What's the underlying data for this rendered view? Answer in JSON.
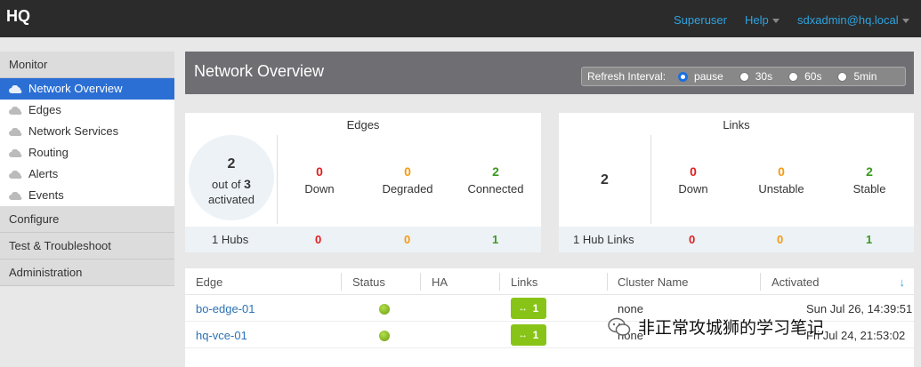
{
  "topbar": {
    "brand": "HQ",
    "superuser": "Superuser",
    "help": "Help",
    "user": "sdxadmin@hq.local"
  },
  "sidebar": {
    "monitor": "Monitor",
    "items": [
      {
        "label": "Network Overview",
        "icon": "cloud-icon",
        "active": true
      },
      {
        "label": "Edges",
        "icon": "cloud-icon"
      },
      {
        "label": "Network Services",
        "icon": "cloud-icon"
      },
      {
        "label": "Routing",
        "icon": "cloud-icon"
      },
      {
        "label": "Alerts",
        "icon": "cloud-icon"
      },
      {
        "label": "Events",
        "icon": "cloud-icon"
      }
    ],
    "configure": "Configure",
    "test": "Test & Troubleshoot",
    "admin": "Administration"
  },
  "banner": {
    "title": "Network Overview",
    "refresh_label": "Refresh Interval:",
    "options": [
      "pause",
      "30s",
      "60s",
      "5min"
    ],
    "selected": "pause"
  },
  "edges_card": {
    "title": "Edges",
    "activated_count": "2",
    "out_of": "out of",
    "total": "3",
    "activated": "activated",
    "down_num": "0",
    "down_label": "Down",
    "degraded_num": "0",
    "degraded_label": "Degraded",
    "connected_num": "2",
    "connected_label": "Connected",
    "hubs": "1 Hubs",
    "hub_down": "0",
    "hub_degraded": "0",
    "hub_connected": "1"
  },
  "links_card": {
    "title": "Links",
    "total": "2",
    "down_num": "0",
    "down_label": "Down",
    "unstable_num": "0",
    "unstable_label": "Unstable",
    "stable_num": "2",
    "stable_label": "Stable",
    "hub_links": "1 Hub Links",
    "hub_down": "0",
    "hub_unstable": "0",
    "hub_stable": "1"
  },
  "table": {
    "headers": [
      "Edge",
      "Status",
      "HA",
      "Links",
      "Cluster Name",
      "Activated"
    ],
    "rows": [
      {
        "edge": "bo-edge-01",
        "links": "1",
        "cluster": "none",
        "activated": "Sun Jul 26, 14:39:51"
      },
      {
        "edge": "hq-vce-01",
        "links": "1",
        "cluster": "none",
        "activated": "Fri Jul 24, 21:53:02"
      }
    ]
  },
  "watermark": "非正常攻城狮的学习笔记",
  "colors": {
    "accent": "#2b6fd4",
    "down": "#e02020",
    "warn": "#f59a12",
    "ok": "#3a9a1e"
  }
}
